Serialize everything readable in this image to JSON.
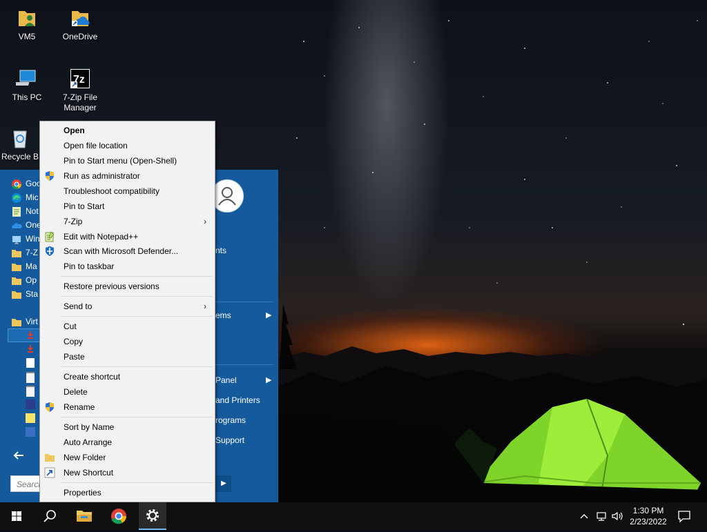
{
  "desktop": {
    "icons": [
      {
        "label": "VM5"
      },
      {
        "label": "OneDrive"
      },
      {
        "label": "This PC"
      },
      {
        "label": "7-Zip File Manager"
      },
      {
        "label": "Recycle B"
      }
    ]
  },
  "start_menu": {
    "programs": [
      {
        "label": "Goo",
        "icon": "chrome-icon"
      },
      {
        "label": "Mic",
        "icon": "edge-icon"
      },
      {
        "label": "Not",
        "icon": "notepad-icon"
      },
      {
        "label": "One",
        "icon": "onedrive-icon"
      },
      {
        "label": "Win",
        "icon": "windows-icon"
      },
      {
        "label": "7-Z",
        "icon": "folder-icon"
      },
      {
        "label": "Ma",
        "icon": "folder-icon"
      },
      {
        "label": "Op",
        "icon": "folder-icon"
      },
      {
        "label": "Sta",
        "icon": "folder-icon"
      },
      {
        "label": "Virt",
        "icon": "folder-icon"
      }
    ],
    "right_items": {
      "documents_tail": "nts",
      "recent_items_tail": "ems",
      "control_panel_tail": "Panel",
      "devices_tail": "and Printers",
      "programs_tail": "rograms",
      "support_tail": "Support"
    },
    "search_placeholder": "Search"
  },
  "context_menu": {
    "items": [
      {
        "label": "Open"
      },
      {
        "label": "Open file location"
      },
      {
        "label": "Pin to Start menu (Open-Shell)"
      },
      {
        "label": "Run as administrator"
      },
      {
        "label": "Troubleshoot compatibility"
      },
      {
        "label": "Pin to Start"
      },
      {
        "label": "7-Zip"
      },
      {
        "label": "Edit with Notepad++"
      },
      {
        "label": "Scan with Microsoft Defender..."
      },
      {
        "label": "Pin to taskbar"
      },
      {
        "label": "Restore previous versions"
      },
      {
        "label": "Send to"
      },
      {
        "label": "Cut"
      },
      {
        "label": "Copy"
      },
      {
        "label": "Paste"
      },
      {
        "label": "Create shortcut"
      },
      {
        "label": "Delete"
      },
      {
        "label": "Rename"
      },
      {
        "label": "Sort by Name"
      },
      {
        "label": "Auto Arrange"
      },
      {
        "label": "New Folder"
      },
      {
        "label": "New Shortcut"
      },
      {
        "label": "Properties"
      }
    ],
    "submenu_arrow": "›"
  },
  "taskbar": {
    "time": "1:30 PM",
    "date": "2/23/2022"
  },
  "colors": {
    "start_menu_bg": "#155a9c",
    "menu_bg": "#f2f2f2",
    "taskbar_bg": "#101010"
  }
}
